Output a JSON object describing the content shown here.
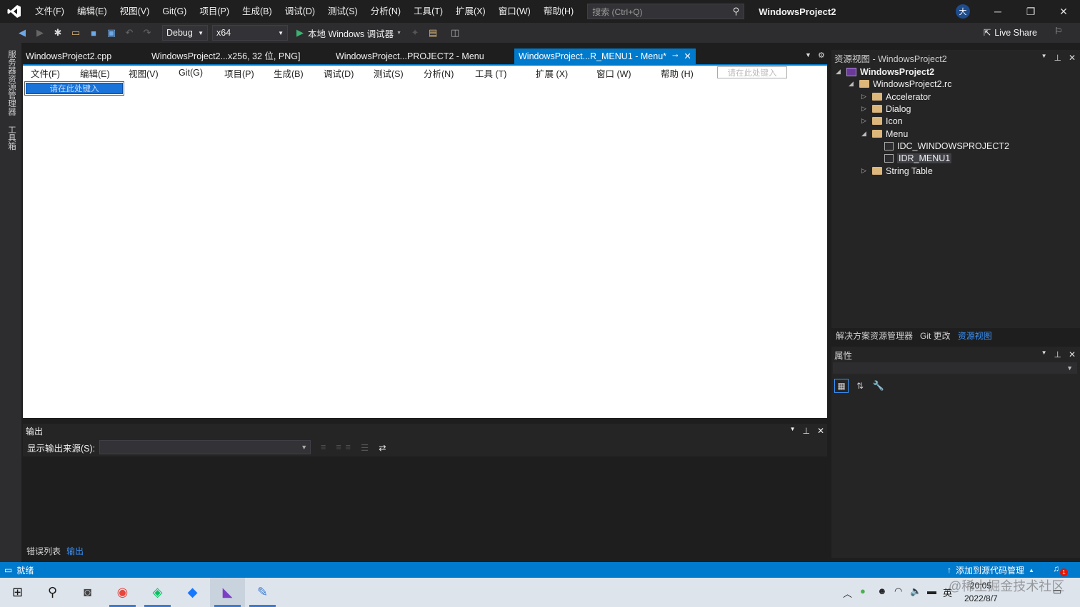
{
  "title_bar": {
    "menu": [
      "文件(F)",
      "编辑(E)",
      "视图(V)",
      "Git(G)",
      "项目(P)",
      "生成(B)",
      "调试(D)",
      "测试(S)",
      "分析(N)",
      "工具(T)",
      "扩展(X)",
      "窗口(W)",
      "帮助(H)"
    ],
    "search_placeholder": "搜索 (Ctrl+Q)",
    "project_name": "WindowsProject2",
    "avatar_initial": "大"
  },
  "toolbar": {
    "configuration": "Debug",
    "platform": "x64",
    "run_label": "本地 Windows 调试器",
    "live_share": "Live Share"
  },
  "left_strip": [
    "服务器资源管理器",
    "工具箱"
  ],
  "doc_tabs": [
    {
      "label": "WindowsProject2.cpp"
    },
    {
      "label": "WindowsProject2...x256, 32 位, PNG]"
    },
    {
      "label": "WindowsProject...PROJECT2 - Menu"
    },
    {
      "label": "WindowsProject...R_MENU1 - Menu*",
      "active": true
    }
  ],
  "menu_editor": {
    "items": [
      "文件(F)",
      "编辑(E)",
      "视图(V)",
      "Git(G)",
      "项目(P)",
      "生成(B)",
      "调试(D)",
      "测试(S)",
      "分析(N)",
      "工具 (T)",
      "扩展 (X)",
      "窗口 (W)",
      "帮助 (H)"
    ],
    "type_here_top": "请在此处键入",
    "type_here_sub": "请在此处键入"
  },
  "output": {
    "title": "输出",
    "source_label": "显示输出来源(S):",
    "tabs": [
      "错误列表",
      "输出"
    ]
  },
  "resource_view": {
    "title": "资源视图 - WindowsProject2",
    "tree": [
      {
        "label": "WindowsProject2",
        "level": 0,
        "icon": "project-icon",
        "expanded": true
      },
      {
        "label": "WindowsProject2.rc",
        "level": 1,
        "icon": "folder-open-icon",
        "expanded": true
      },
      {
        "label": "Accelerator",
        "level": 2,
        "icon": "folder-icon",
        "expanded": false
      },
      {
        "label": "Dialog",
        "level": 2,
        "icon": "folder-icon",
        "expanded": false
      },
      {
        "label": "Icon",
        "level": 2,
        "icon": "folder-icon",
        "expanded": false
      },
      {
        "label": "Menu",
        "level": 2,
        "icon": "folder-open-icon",
        "expanded": true
      },
      {
        "label": "IDC_WINDOWSPROJECT2",
        "level": 3,
        "icon": "menu-resource-icon"
      },
      {
        "label": "IDR_MENU1",
        "level": 3,
        "icon": "menu-resource-icon",
        "selected": true
      },
      {
        "label": "String Table",
        "level": 2,
        "icon": "folder-icon",
        "expanded": false
      }
    ]
  },
  "right_tabs": [
    "解决方案资源管理器",
    "Git 更改",
    "资源视图"
  ],
  "properties": {
    "title": "属性"
  },
  "status_bar": {
    "ready": "就绪",
    "source_control": "添加到源代码管理",
    "notifications": "1"
  },
  "taskbar": {
    "time": "20:05",
    "date": "2022/8/7",
    "ime": "英",
    "watermark": "@稀土掘金技术社区"
  },
  "colors": {
    "accent": "#007acc",
    "background": "#1e1e1e",
    "panel": "#252526",
    "selection": "#1a73d9"
  }
}
